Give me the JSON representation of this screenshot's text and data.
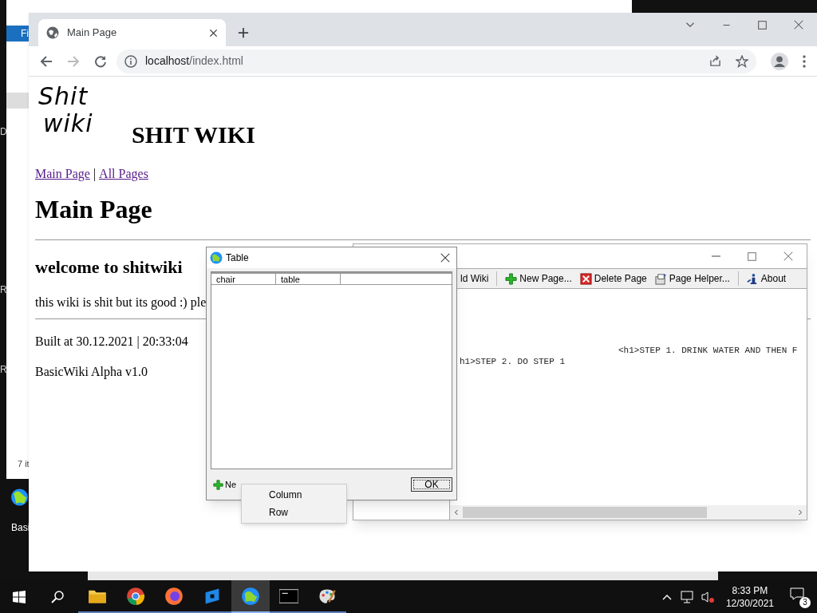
{
  "background_window": {
    "ribbon_tab": "Fi",
    "side_letters": [
      "D",
      "R",
      "R"
    ],
    "status_text": "7 it"
  },
  "desktop_icons": [
    {
      "label": "Basi"
    }
  ],
  "browser": {
    "tab": {
      "title": "Main Page",
      "selected": true
    },
    "address_host": "localhost",
    "address_path": "/index.html",
    "page": {
      "logo_lines": [
        "Shit",
        "wiki"
      ],
      "site_title": "SHIT WIKI",
      "nav": [
        {
          "label": "Main Page"
        },
        {
          "label": "All Pages"
        }
      ],
      "nav_separator": "|",
      "heading": "Main Page",
      "subheading": "welcome to shitwiki",
      "paragraph": "this wiki is shit but its good :) ple",
      "built": "Built at 30.12.2021 | 20:33:04",
      "version": "BasicWiki Alpha v1.0"
    }
  },
  "editor": {
    "toolbar": [
      {
        "label": "ld Wiki",
        "kind": "text"
      },
      {
        "label": "New Page...",
        "kind": "plus"
      },
      {
        "label": "Delete Page",
        "kind": "delete"
      },
      {
        "label": "Page Helper...",
        "kind": "helper"
      },
      {
        "label": "About",
        "kind": "about"
      }
    ],
    "code_lines": [
      "<h1>STEP 1. DRINK WATER AND THEN F",
      "h1>STEP 2. DO STEP 1"
    ]
  },
  "table_dialog": {
    "title": "Table",
    "columns": [
      "chair",
      "table"
    ],
    "new_button": "Ne",
    "ok_button": "OK"
  },
  "context_menu": {
    "items": [
      "Column",
      "Row"
    ]
  },
  "taskbar": {
    "apps": [
      {
        "kind": "folder",
        "selected": false
      },
      {
        "kind": "chrome",
        "selected": false
      },
      {
        "kind": "firefox",
        "selected": false
      },
      {
        "kind": "blocks",
        "selected": false
      },
      {
        "kind": "globe",
        "selected": true
      },
      {
        "kind": "terminal",
        "selected": false
      },
      {
        "kind": "paint",
        "selected": false
      }
    ],
    "time": "8:33 PM",
    "date": "12/30/2021",
    "notifications": "3"
  }
}
